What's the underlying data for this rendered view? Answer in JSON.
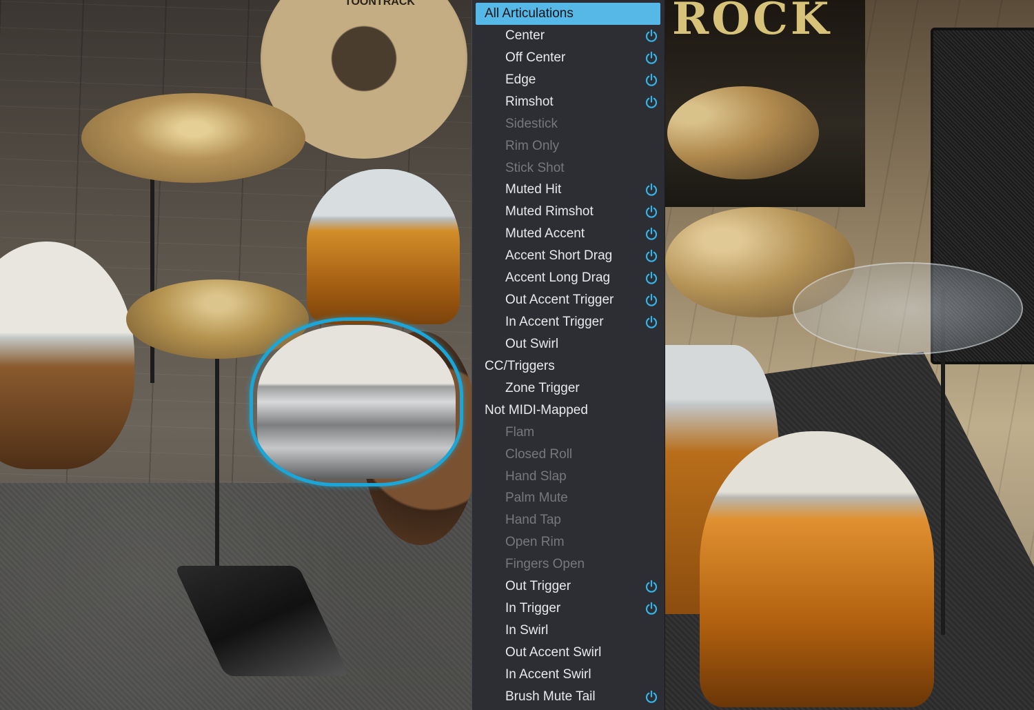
{
  "scene": {
    "brand_text": "TOONTRACK",
    "banner_text": "ROCK"
  },
  "menu": {
    "accent_color": "#56b8e6",
    "power_icon_color": "#35b4e8",
    "items": [
      {
        "label": "All Articulations",
        "kind": "selected",
        "power": false
      },
      {
        "label": "Center",
        "kind": "sub",
        "power": true
      },
      {
        "label": "Off Center",
        "kind": "sub",
        "power": true
      },
      {
        "label": "Edge",
        "kind": "sub",
        "power": true
      },
      {
        "label": "Rimshot",
        "kind": "sub",
        "power": true
      },
      {
        "label": "Sidestick",
        "kind": "sub-disabled",
        "power": false
      },
      {
        "label": "Rim Only",
        "kind": "sub-disabled",
        "power": false
      },
      {
        "label": "Stick Shot",
        "kind": "sub-disabled",
        "power": false
      },
      {
        "label": "Muted Hit",
        "kind": "sub",
        "power": true
      },
      {
        "label": "Muted Rimshot",
        "kind": "sub",
        "power": true
      },
      {
        "label": "Muted Accent",
        "kind": "sub",
        "power": true
      },
      {
        "label": "Accent Short Drag",
        "kind": "sub",
        "power": true
      },
      {
        "label": "Accent Long Drag",
        "kind": "sub",
        "power": true
      },
      {
        "label": "Out Accent Trigger",
        "kind": "sub",
        "power": true
      },
      {
        "label": "In Accent Trigger",
        "kind": "sub",
        "power": true
      },
      {
        "label": "Out Swirl",
        "kind": "sub",
        "power": false
      },
      {
        "label": "CC/Triggers",
        "kind": "group",
        "power": false
      },
      {
        "label": "Zone Trigger",
        "kind": "sub",
        "power": false
      },
      {
        "label": "Not MIDI-Mapped",
        "kind": "group",
        "power": false
      },
      {
        "label": "Flam",
        "kind": "sub-disabled",
        "power": false
      },
      {
        "label": "Closed Roll",
        "kind": "sub-disabled",
        "power": false
      },
      {
        "label": "Hand Slap",
        "kind": "sub-disabled",
        "power": false
      },
      {
        "label": "Palm Mute",
        "kind": "sub-disabled",
        "power": false
      },
      {
        "label": "Hand Tap",
        "kind": "sub-disabled",
        "power": false
      },
      {
        "label": "Open Rim",
        "kind": "sub-disabled",
        "power": false
      },
      {
        "label": "Fingers Open",
        "kind": "sub-disabled",
        "power": false
      },
      {
        "label": "Out Trigger",
        "kind": "sub",
        "power": true
      },
      {
        "label": "In Trigger",
        "kind": "sub",
        "power": true
      },
      {
        "label": "In Swirl",
        "kind": "sub",
        "power": false
      },
      {
        "label": "Out Accent Swirl",
        "kind": "sub",
        "power": false
      },
      {
        "label": "In Accent Swirl",
        "kind": "sub",
        "power": false
      },
      {
        "label": "Brush Mute Tail",
        "kind": "sub",
        "power": true
      }
    ]
  }
}
